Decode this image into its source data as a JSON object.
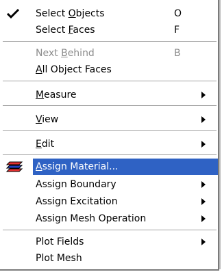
{
  "menu": {
    "items": [
      {
        "pre": "Select ",
        "u": "O",
        "post": "bjects",
        "shortcut": "O"
      },
      {
        "pre": "Select ",
        "u": "F",
        "post": "aces",
        "shortcut": "F"
      },
      {
        "pre": "Next ",
        "u": "B",
        "post": "ehind",
        "shortcut": "B"
      },
      {
        "pre": "",
        "u": "A",
        "post": "ll Object Faces"
      },
      {
        "pre": "",
        "u": "M",
        "post": "easure"
      },
      {
        "pre": "",
        "u": "V",
        "post": "iew"
      },
      {
        "pre": "",
        "u": "E",
        "post": "dit"
      },
      {
        "pre": "",
        "u": "A",
        "post": "ssign Material..."
      },
      {
        "text": "Assign Boundary"
      },
      {
        "text": "Assign Excitation"
      },
      {
        "text": "Assign Mesh Operation"
      },
      {
        "text": "Plot Fields"
      },
      {
        "text": "Plot Mesh"
      }
    ]
  },
  "icons": {
    "check": "checkmark-icon",
    "material": "assign-material-icon",
    "submenu": "submenu-arrow-icon"
  },
  "colors": {
    "highlight": "#2f62c4",
    "disabled_text": "#8c8c8c"
  }
}
